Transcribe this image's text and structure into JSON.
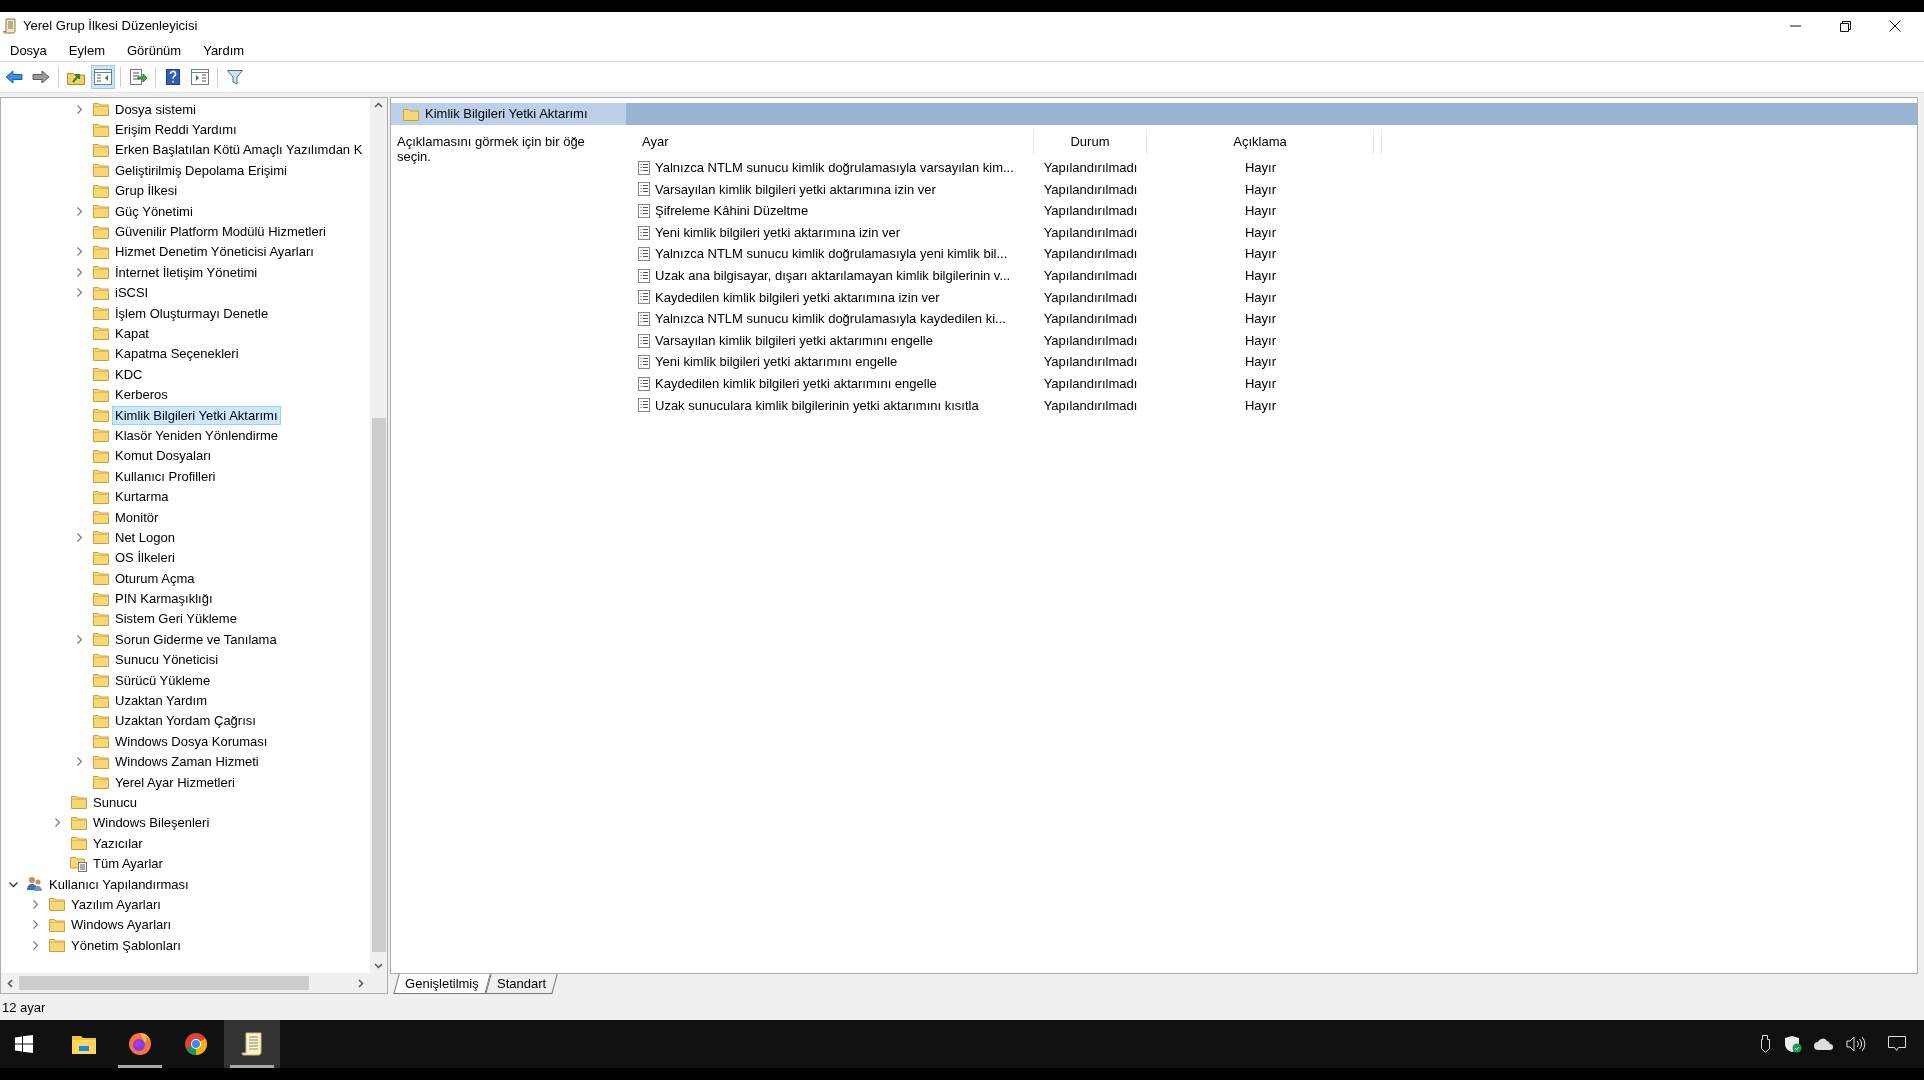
{
  "window": {
    "title": "Yerel Grup İlkesi Düzenleyicisi"
  },
  "menu": [
    "Dosya",
    "Eylem",
    "Görünüm",
    "Yardım"
  ],
  "toolbar": [
    {
      "kind": "back",
      "pressed": false
    },
    {
      "kind": "forward",
      "pressed": false
    },
    {
      "kind": "up",
      "pressed": false
    },
    {
      "kind": "tree-toggle",
      "pressed": true
    },
    {
      "kind": "export",
      "pressed": false
    },
    {
      "kind": "help",
      "pressed": false
    },
    {
      "kind": "action-pane",
      "pressed": false
    },
    {
      "kind": "filter",
      "pressed": false
    }
  ],
  "tree": [
    {
      "children": [
        {
          "children": [
            {
              "children": [
                {
                  "label": "Dosya sistemi",
                  "kind": "folder",
                  "expandable": true,
                  "expanded": false,
                  "selected": false
                },
                {
                  "label": "Erişim Reddi Yardımı",
                  "kind": "folder",
                  "expandable": false,
                  "selected": false
                },
                {
                  "label": "Erken Başlatılan Kötü Amaçlı Yazılımdan K",
                  "kind": "folder",
                  "expandable": false,
                  "selected": false
                },
                {
                  "label": "Geliştirilmiş Depolama Erişimi",
                  "kind": "folder",
                  "expandable": false,
                  "selected": false
                },
                {
                  "label": "Grup İlkesi",
                  "kind": "folder",
                  "expandable": false,
                  "selected": false
                },
                {
                  "label": "Güç Yönetimi",
                  "kind": "folder",
                  "expandable": true,
                  "expanded": false,
                  "selected": false
                },
                {
                  "label": "Güvenilir Platform Modülü Hizmetleri",
                  "kind": "folder",
                  "expandable": false,
                  "selected": false
                },
                {
                  "label": "Hizmet Denetim Yöneticisi Ayarları",
                  "kind": "folder",
                  "expandable": true,
                  "expanded": false,
                  "selected": false
                },
                {
                  "label": "İnternet İletişim Yönetimi",
                  "kind": "folder",
                  "expandable": true,
                  "expanded": false,
                  "selected": false
                },
                {
                  "label": "iSCSI",
                  "kind": "folder",
                  "expandable": true,
                  "expanded": false,
                  "selected": false
                },
                {
                  "label": "İşlem Oluşturmayı Denetle",
                  "kind": "folder",
                  "expandable": false,
                  "selected": false
                },
                {
                  "label": "Kapat",
                  "kind": "folder",
                  "expandable": false,
                  "selected": false
                },
                {
                  "label": "Kapatma Seçenekleri",
                  "kind": "folder",
                  "expandable": false,
                  "selected": false
                },
                {
                  "label": "KDC",
                  "kind": "folder",
                  "expandable": false,
                  "selected": false
                },
                {
                  "label": "Kerberos",
                  "kind": "folder",
                  "expandable": false,
                  "selected": false
                },
                {
                  "label": "Kimlik Bilgileri Yetki Aktarımı",
                  "kind": "folder",
                  "expandable": false,
                  "selected": true
                },
                {
                  "label": "Klasör Yeniden Yönlendirme",
                  "kind": "folder",
                  "expandable": false,
                  "selected": false
                },
                {
                  "label": "Komut Dosyaları",
                  "kind": "folder",
                  "expandable": false,
                  "selected": false
                },
                {
                  "label": "Kullanıcı Profilleri",
                  "kind": "folder",
                  "expandable": false,
                  "selected": false
                },
                {
                  "label": "Kurtarma",
                  "kind": "folder",
                  "expandable": false,
                  "selected": false
                },
                {
                  "label": "Monitör",
                  "kind": "folder",
                  "expandable": false,
                  "selected": false
                },
                {
                  "label": "Net Logon",
                  "kind": "folder",
                  "expandable": true,
                  "expanded": false,
                  "selected": false
                },
                {
                  "label": "OS İlkeleri",
                  "kind": "folder",
                  "expandable": false,
                  "selected": false
                },
                {
                  "label": "Oturum Açma",
                  "kind": "folder",
                  "expandable": false,
                  "selected": false
                },
                {
                  "label": "PIN Karmaşıklığı",
                  "kind": "folder",
                  "expandable": false,
                  "selected": false
                },
                {
                  "label": "Sistem Geri Yükleme",
                  "kind": "folder",
                  "expandable": false,
                  "selected": false
                },
                {
                  "label": "Sorun Giderme ve Tanılama",
                  "kind": "folder",
                  "expandable": true,
                  "expanded": false,
                  "selected": false
                },
                {
                  "label": "Sunucu Yöneticisi",
                  "kind": "folder",
                  "expandable": false,
                  "selected": false
                },
                {
                  "label": "Sürücü Yükleme",
                  "kind": "folder",
                  "expandable": false,
                  "selected": false
                },
                {
                  "label": "Uzaktan Yardım",
                  "kind": "folder",
                  "expandable": false,
                  "selected": false
                },
                {
                  "label": "Uzaktan Yordam Çağrısı",
                  "kind": "folder",
                  "expandable": false,
                  "selected": false
                },
                {
                  "label": "Windows Dosya Koruması",
                  "kind": "folder",
                  "expandable": false,
                  "selected": false
                },
                {
                  "label": "Windows Zaman Hizmeti",
                  "kind": "folder",
                  "expandable": true,
                  "expanded": false,
                  "selected": false
                },
                {
                  "label": "Yerel Ayar Hizmetleri",
                  "kind": "folder",
                  "expandable": false,
                  "selected": false
                }
              ]
            },
            {
              "label": "Sunucu",
              "kind": "folder",
              "expandable": false,
              "selected": false
            },
            {
              "label": "Windows Bileşenleri",
              "kind": "folder",
              "expandable": true,
              "expanded": false,
              "selected": false
            },
            {
              "label": "Yazıcılar",
              "kind": "folder",
              "expandable": false,
              "selected": false
            },
            {
              "label": "Tüm Ayarlar",
              "kind": "settings-folder",
              "expandable": false,
              "selected": false
            }
          ]
        }
      ]
    },
    {
      "label": "Kullanıcı Yapılandırması",
      "kind": "user",
      "expandable": true,
      "expanded": true,
      "selected": false,
      "children": [
        {
          "label": "Yazılım Ayarları",
          "kind": "folder",
          "expandable": true,
          "expanded": false,
          "selected": false
        },
        {
          "label": "Windows Ayarları",
          "kind": "folder",
          "expandable": true,
          "expanded": false,
          "selected": false
        },
        {
          "label": "Yönetim Şablonları",
          "kind": "folder",
          "expandable": true,
          "expanded": false,
          "selected": false
        }
      ]
    }
  ],
  "details": {
    "header": "Kimlik Bilgileri Yetki Aktarımı",
    "description": "Açıklamasını görmek için bir öğe seçin.",
    "columns": [
      "Ayar",
      "Durum",
      "Açıklama"
    ],
    "rows": [
      {
        "setting": "Yalnızca NTLM sunucu kimlik doğrulamasıyla varsayılan kim...",
        "state": "Yapılandırılmadı",
        "comment": "Hayır"
      },
      {
        "setting": "Varsayılan kimlik bilgileri yetki aktarımına izin ver",
        "state": "Yapılandırılmadı",
        "comment": "Hayır"
      },
      {
        "setting": "Şifreleme Kâhini Düzeltme",
        "state": "Yapılandırılmadı",
        "comment": "Hayır"
      },
      {
        "setting": "Yeni kimlik bilgileri yetki aktarımına izin ver",
        "state": "Yapılandırılmadı",
        "comment": "Hayır"
      },
      {
        "setting": "Yalnızca NTLM sunucu kimlik doğrulamasıyla yeni kimlik bil...",
        "state": "Yapılandırılmadı",
        "comment": "Hayır"
      },
      {
        "setting": "Uzak ana bilgisayar, dışarı aktarılamayan kimlik bilgilerinin v...",
        "state": "Yapılandırılmadı",
        "comment": "Hayır"
      },
      {
        "setting": "Kaydedilen kimlik bilgileri yetki aktarımına izin ver",
        "state": "Yapılandırılmadı",
        "comment": "Hayır"
      },
      {
        "setting": "Yalnızca NTLM sunucu kimlik doğrulamasıyla kaydedilen ki...",
        "state": "Yapılandırılmadı",
        "comment": "Hayır"
      },
      {
        "setting": "Varsayılan kimlik bilgileri yetki aktarımını engelle",
        "state": "Yapılandırılmadı",
        "comment": "Hayır"
      },
      {
        "setting": "Yeni kimlik bilgileri yetki aktarımını engelle",
        "state": "Yapılandırılmadı",
        "comment": "Hayır"
      },
      {
        "setting": "Kaydedilen kimlik bilgileri yetki aktarımını engelle",
        "state": "Yapılandırılmadı",
        "comment": "Hayır"
      },
      {
        "setting": "Uzak sunuculara kimlik bilgilerinin yetki aktarımını kısıtla",
        "state": "Yapılandırılmadı",
        "comment": "Hayır"
      }
    ]
  },
  "view_tabs": [
    {
      "label": "Genişletilmiş",
      "selected": true
    },
    {
      "label": "Standart",
      "selected": false
    }
  ],
  "status_bar": "12 ayar",
  "taskbar": [
    {
      "kind": "start",
      "running": false,
      "active": false
    },
    {
      "kind": "explorer",
      "running": false,
      "active": false
    },
    {
      "kind": "firefox",
      "running": true,
      "active": false
    },
    {
      "kind": "chrome",
      "running": false,
      "active": false
    },
    {
      "kind": "policy-editor",
      "running": true,
      "active": true
    }
  ]
}
